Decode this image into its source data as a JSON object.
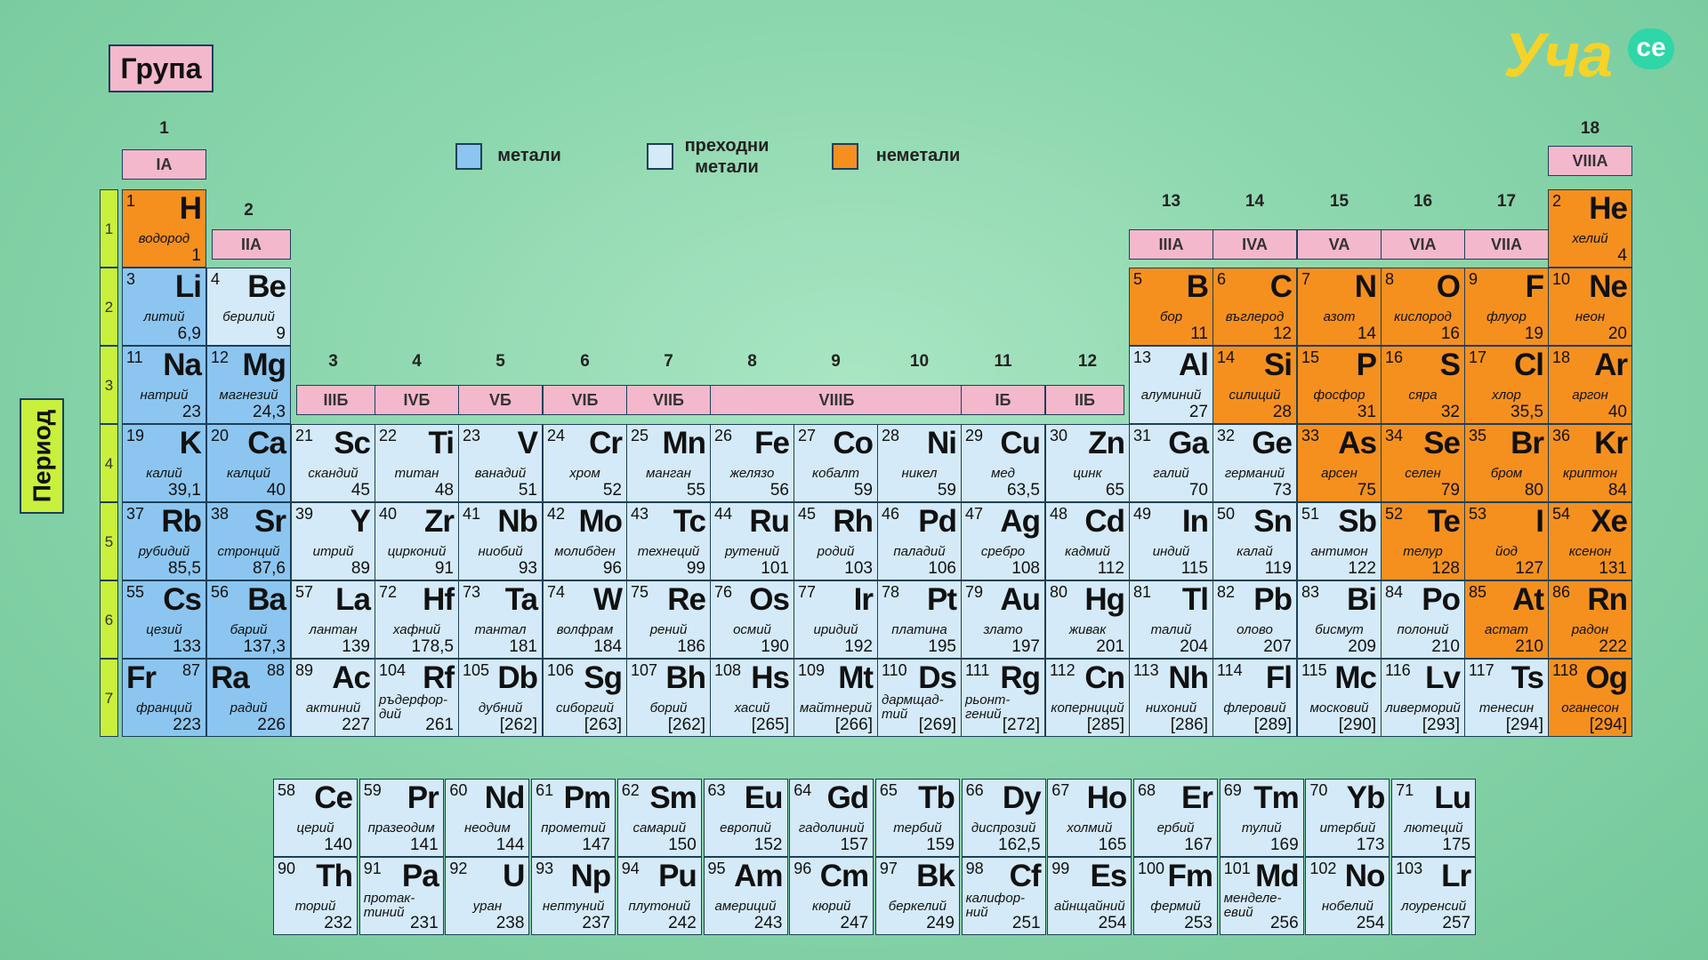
{
  "header": {
    "group_title": "Група",
    "period_title": "Период"
  },
  "logo": {
    "text": "Уча",
    "suffix": "се",
    "color_main": "#f5d327",
    "color_badge": "#2fd6a8"
  },
  "colors": {
    "metal": "#8cc6f0",
    "transition": "#d4eaf8",
    "nonmetal": "#f5901f",
    "label": "#f4b8cc",
    "period_bar": "#c8f03c"
  },
  "legend": [
    {
      "label": "метали",
      "category": "metal"
    },
    {
      "label": "преходни метали",
      "category": "trans"
    },
    {
      "label": "неметали",
      "category": "nonmetal"
    }
  ],
  "periods": [
    "1",
    "2",
    "3",
    "4",
    "5",
    "6",
    "7"
  ],
  "group_numbers": [
    "1",
    "2",
    "3",
    "4",
    "5",
    "6",
    "7",
    "8",
    "9",
    "10",
    "11",
    "12",
    "13",
    "14",
    "15",
    "16",
    "17",
    "18"
  ],
  "group_labels": {
    "g1": "IA",
    "g2": "IIA",
    "g3": "IIIБ",
    "g4": "IVБ",
    "g5": "VБ",
    "g6": "VIБ",
    "g7": "VIIБ",
    "g8_10": "VIIIБ",
    "g11": "IБ",
    "g12": "IIБ",
    "g13": "IIIA",
    "g14": "IVA",
    "g15": "VA",
    "g16": "VIA",
    "g17": "VIIA",
    "g18": "VIIIA"
  },
  "elements": [
    {
      "n": "1",
      "s": "H",
      "name": "водород",
      "m": "1",
      "r": 1,
      "c": 1,
      "cat": "nonmetal"
    },
    {
      "n": "2",
      "s": "He",
      "name": "хелий",
      "m": "4",
      "r": 1,
      "c": 18,
      "cat": "nonmetal"
    },
    {
      "n": "3",
      "s": "Li",
      "name": "литий",
      "m": "6,9",
      "r": 2,
      "c": 1,
      "cat": "metal"
    },
    {
      "n": "4",
      "s": "Be",
      "name": "берилий",
      "m": "9",
      "r": 2,
      "c": 2,
      "cat": "trans"
    },
    {
      "n": "5",
      "s": "B",
      "name": "бор",
      "m": "11",
      "r": 2,
      "c": 13,
      "cat": "nonmetal"
    },
    {
      "n": "6",
      "s": "C",
      "name": "въглерод",
      "m": "12",
      "r": 2,
      "c": 14,
      "cat": "nonmetal"
    },
    {
      "n": "7",
      "s": "N",
      "name": "азот",
      "m": "14",
      "r": 2,
      "c": 15,
      "cat": "nonmetal"
    },
    {
      "n": "8",
      "s": "O",
      "name": "кислород",
      "m": "16",
      "r": 2,
      "c": 16,
      "cat": "nonmetal"
    },
    {
      "n": "9",
      "s": "F",
      "name": "флуор",
      "m": "19",
      "r": 2,
      "c": 17,
      "cat": "nonmetal"
    },
    {
      "n": "10",
      "s": "Ne",
      "name": "неон",
      "m": "20",
      "r": 2,
      "c": 18,
      "cat": "nonmetal"
    },
    {
      "n": "11",
      "s": "Na",
      "name": "натрий",
      "m": "23",
      "r": 3,
      "c": 1,
      "cat": "metal"
    },
    {
      "n": "12",
      "s": "Mg",
      "name": "магнезий",
      "m": "24,3",
      "r": 3,
      "c": 2,
      "cat": "metal"
    },
    {
      "n": "13",
      "s": "Al",
      "name": "алуминий",
      "m": "27",
      "r": 3,
      "c": 13,
      "cat": "trans"
    },
    {
      "n": "14",
      "s": "Si",
      "name": "силиций",
      "m": "28",
      "r": 3,
      "c": 14,
      "cat": "nonmetal"
    },
    {
      "n": "15",
      "s": "P",
      "name": "фосфор",
      "m": "31",
      "r": 3,
      "c": 15,
      "cat": "nonmetal"
    },
    {
      "n": "16",
      "s": "S",
      "name": "сяра",
      "m": "32",
      "r": 3,
      "c": 16,
      "cat": "nonmetal"
    },
    {
      "n": "17",
      "s": "Cl",
      "name": "хлор",
      "m": "35,5",
      "r": 3,
      "c": 17,
      "cat": "nonmetal"
    },
    {
      "n": "18",
      "s": "Ar",
      "name": "аргон",
      "m": "40",
      "r": 3,
      "c": 18,
      "cat": "nonmetal"
    },
    {
      "n": "19",
      "s": "K",
      "name": "калий",
      "m": "39,1",
      "r": 4,
      "c": 1,
      "cat": "metal"
    },
    {
      "n": "20",
      "s": "Ca",
      "name": "калций",
      "m": "40",
      "r": 4,
      "c": 2,
      "cat": "metal"
    },
    {
      "n": "21",
      "s": "Sc",
      "name": "скандий",
      "m": "45",
      "r": 4,
      "c": 3,
      "cat": "trans"
    },
    {
      "n": "22",
      "s": "Ti",
      "name": "титан",
      "m": "48",
      "r": 4,
      "c": 4,
      "cat": "trans"
    },
    {
      "n": "23",
      "s": "V",
      "name": "ванадий",
      "m": "51",
      "r": 4,
      "c": 5,
      "cat": "trans"
    },
    {
      "n": "24",
      "s": "Cr",
      "name": "хром",
      "m": "52",
      "r": 4,
      "c": 6,
      "cat": "trans"
    },
    {
      "n": "25",
      "s": "Mn",
      "name": "манган",
      "m": "55",
      "r": 4,
      "c": 7,
      "cat": "trans"
    },
    {
      "n": "26",
      "s": "Fe",
      "name": "желязо",
      "m": "56",
      "r": 4,
      "c": 8,
      "cat": "trans"
    },
    {
      "n": "27",
      "s": "Co",
      "name": "кобалт",
      "m": "59",
      "r": 4,
      "c": 9,
      "cat": "trans"
    },
    {
      "n": "28",
      "s": "Ni",
      "name": "никел",
      "m": "59",
      "r": 4,
      "c": 10,
      "cat": "trans"
    },
    {
      "n": "29",
      "s": "Cu",
      "name": "мед",
      "m": "63,5",
      "r": 4,
      "c": 11,
      "cat": "trans"
    },
    {
      "n": "30",
      "s": "Zn",
      "name": "цинк",
      "m": "65",
      "r": 4,
      "c": 12,
      "cat": "trans"
    },
    {
      "n": "31",
      "s": "Ga",
      "name": "галий",
      "m": "70",
      "r": 4,
      "c": 13,
      "cat": "trans"
    },
    {
      "n": "32",
      "s": "Ge",
      "name": "германий",
      "m": "73",
      "r": 4,
      "c": 14,
      "cat": "trans"
    },
    {
      "n": "33",
      "s": "As",
      "name": "арсен",
      "m": "75",
      "r": 4,
      "c": 15,
      "cat": "nonmetal"
    },
    {
      "n": "34",
      "s": "Se",
      "name": "селен",
      "m": "79",
      "r": 4,
      "c": 16,
      "cat": "nonmetal"
    },
    {
      "n": "35",
      "s": "Br",
      "name": "бром",
      "m": "80",
      "r": 4,
      "c": 17,
      "cat": "nonmetal"
    },
    {
      "n": "36",
      "s": "Kr",
      "name": "криптон",
      "m": "84",
      "r": 4,
      "c": 18,
      "cat": "nonmetal"
    },
    {
      "n": "37",
      "s": "Rb",
      "name": "рубидий",
      "m": "85,5",
      "r": 5,
      "c": 1,
      "cat": "metal"
    },
    {
      "n": "38",
      "s": "Sr",
      "name": "стронций",
      "m": "87,6",
      "r": 5,
      "c": 2,
      "cat": "metal"
    },
    {
      "n": "39",
      "s": "Y",
      "name": "итрий",
      "m": "89",
      "r": 5,
      "c": 3,
      "cat": "trans"
    },
    {
      "n": "40",
      "s": "Zr",
      "name": "цирконий",
      "m": "91",
      "r": 5,
      "c": 4,
      "cat": "trans"
    },
    {
      "n": "41",
      "s": "Nb",
      "name": "ниобий",
      "m": "93",
      "r": 5,
      "c": 5,
      "cat": "trans"
    },
    {
      "n": "42",
      "s": "Mo",
      "name": "молибден",
      "m": "96",
      "r": 5,
      "c": 6,
      "cat": "trans"
    },
    {
      "n": "43",
      "s": "Tc",
      "name": "технеций",
      "m": "99",
      "r": 5,
      "c": 7,
      "cat": "trans"
    },
    {
      "n": "44",
      "s": "Ru",
      "name": "рутений",
      "m": "101",
      "r": 5,
      "c": 8,
      "cat": "trans"
    },
    {
      "n": "45",
      "s": "Rh",
      "name": "родий",
      "m": "103",
      "r": 5,
      "c": 9,
      "cat": "trans"
    },
    {
      "n": "46",
      "s": "Pd",
      "name": "паладий",
      "m": "106",
      "r": 5,
      "c": 10,
      "cat": "trans"
    },
    {
      "n": "47",
      "s": "Ag",
      "name": "сребро",
      "m": "108",
      "r": 5,
      "c": 11,
      "cat": "trans"
    },
    {
      "n": "48",
      "s": "Cd",
      "name": "кадмий",
      "m": "112",
      "r": 5,
      "c": 12,
      "cat": "trans"
    },
    {
      "n": "49",
      "s": "In",
      "name": "индий",
      "m": "115",
      "r": 5,
      "c": 13,
      "cat": "trans"
    },
    {
      "n": "50",
      "s": "Sn",
      "name": "калай",
      "m": "119",
      "r": 5,
      "c": 14,
      "cat": "trans"
    },
    {
      "n": "51",
      "s": "Sb",
      "name": "антимон",
      "m": "122",
      "r": 5,
      "c": 15,
      "cat": "trans"
    },
    {
      "n": "52",
      "s": "Te",
      "name": "телур",
      "m": "128",
      "r": 5,
      "c": 16,
      "cat": "nonmetal"
    },
    {
      "n": "53",
      "s": "I",
      "name": "йод",
      "m": "127",
      "r": 5,
      "c": 17,
      "cat": "nonmetal"
    },
    {
      "n": "54",
      "s": "Xe",
      "name": "ксенон",
      "m": "131",
      "r": 5,
      "c": 18,
      "cat": "nonmetal"
    },
    {
      "n": "55",
      "s": "Cs",
      "name": "цезий",
      "m": "133",
      "r": 6,
      "c": 1,
      "cat": "metal"
    },
    {
      "n": "56",
      "s": "Ba",
      "name": "барий",
      "m": "137,3",
      "r": 6,
      "c": 2,
      "cat": "metal"
    },
    {
      "n": "57",
      "s": "La",
      "name": "лантан",
      "m": "139",
      "r": 6,
      "c": 3,
      "cat": "trans"
    },
    {
      "n": "72",
      "s": "Hf",
      "name": "хафний",
      "m": "178,5",
      "r": 6,
      "c": 4,
      "cat": "trans"
    },
    {
      "n": "73",
      "s": "Ta",
      "name": "тантал",
      "m": "181",
      "r": 6,
      "c": 5,
      "cat": "trans"
    },
    {
      "n": "74",
      "s": "W",
      "name": "волфрам",
      "m": "184",
      "r": 6,
      "c": 6,
      "cat": "trans"
    },
    {
      "n": "75",
      "s": "Re",
      "name": "рений",
      "m": "186",
      "r": 6,
      "c": 7,
      "cat": "trans"
    },
    {
      "n": "76",
      "s": "Os",
      "name": "осмий",
      "m": "190",
      "r": 6,
      "c": 8,
      "cat": "trans"
    },
    {
      "n": "77",
      "s": "Ir",
      "name": "иридий",
      "m": "192",
      "r": 6,
      "c": 9,
      "cat": "trans"
    },
    {
      "n": "78",
      "s": "Pt",
      "name": "платина",
      "m": "195",
      "r": 6,
      "c": 10,
      "cat": "trans"
    },
    {
      "n": "79",
      "s": "Au",
      "name": "злато",
      "m": "197",
      "r": 6,
      "c": 11,
      "cat": "trans"
    },
    {
      "n": "80",
      "s": "Hg",
      "name": "живак",
      "m": "201",
      "r": 6,
      "c": 12,
      "cat": "trans"
    },
    {
      "n": "81",
      "s": "Tl",
      "name": "талий",
      "m": "204",
      "r": 6,
      "c": 13,
      "cat": "trans"
    },
    {
      "n": "82",
      "s": "Pb",
      "name": "олово",
      "m": "207",
      "r": 6,
      "c": 14,
      "cat": "trans"
    },
    {
      "n": "83",
      "s": "Bi",
      "name": "бисмут",
      "m": "209",
      "r": 6,
      "c": 15,
      "cat": "trans"
    },
    {
      "n": "84",
      "s": "Po",
      "name": "полоний",
      "m": "210",
      "r": 6,
      "c": 16,
      "cat": "trans"
    },
    {
      "n": "85",
      "s": "At",
      "name": "астат",
      "m": "210",
      "r": 6,
      "c": 17,
      "cat": "nonmetal"
    },
    {
      "n": "86",
      "s": "Rn",
      "name": "радон",
      "m": "222",
      "r": 6,
      "c": 18,
      "cat": "nonmetal"
    },
    {
      "n": "87",
      "s": "Fr",
      "name": "франций",
      "m": "223",
      "r": 7,
      "c": 1,
      "cat": "metal",
      "flip": true
    },
    {
      "n": "88",
      "s": "Ra",
      "name": "радий",
      "m": "226",
      "r": 7,
      "c": 2,
      "cat": "metal",
      "flip": true
    },
    {
      "n": "89",
      "s": "Ac",
      "name": "актиний",
      "m": "227",
      "r": 7,
      "c": 3,
      "cat": "trans"
    },
    {
      "n": "104",
      "s": "Rf",
      "name": "ръдерфор-\nдий",
      "m": "261",
      "r": 7,
      "c": 4,
      "cat": "trans"
    },
    {
      "n": "105",
      "s": "Db",
      "name": "дубний",
      "m": "[262]",
      "r": 7,
      "c": 5,
      "cat": "trans"
    },
    {
      "n": "106",
      "s": "Sg",
      "name": "сиборгий",
      "m": "[263]",
      "r": 7,
      "c": 6,
      "cat": "trans"
    },
    {
      "n": "107",
      "s": "Bh",
      "name": "борий",
      "m": "[262]",
      "r": 7,
      "c": 7,
      "cat": "trans"
    },
    {
      "n": "108",
      "s": "Hs",
      "name": "хасий",
      "m": "[265]",
      "r": 7,
      "c": 8,
      "cat": "trans"
    },
    {
      "n": "109",
      "s": "Mt",
      "name": "майтнерий",
      "m": "[266]",
      "r": 7,
      "c": 9,
      "cat": "trans"
    },
    {
      "n": "110",
      "s": "Ds",
      "name": "дармщад-\nтий",
      "m": "[269]",
      "r": 7,
      "c": 10,
      "cat": "trans"
    },
    {
      "n": "111",
      "s": "Rg",
      "name": "рьонт-\nгений",
      "m": "[272]",
      "r": 7,
      "c": 11,
      "cat": "trans"
    },
    {
      "n": "112",
      "s": "Cn",
      "name": "коперниций",
      "m": "[285]",
      "r": 7,
      "c": 12,
      "cat": "trans"
    },
    {
      "n": "113",
      "s": "Nh",
      "name": "нихоний",
      "m": "[286]",
      "r": 7,
      "c": 13,
      "cat": "trans"
    },
    {
      "n": "114",
      "s": "Fl",
      "name": "флеровий",
      "m": "[289]",
      "r": 7,
      "c": 14,
      "cat": "trans"
    },
    {
      "n": "115",
      "s": "Mc",
      "name": "московий",
      "m": "[290]",
      "r": 7,
      "c": 15,
      "cat": "trans"
    },
    {
      "n": "116",
      "s": "Lv",
      "name": "ливерморий",
      "m": "[293]",
      "r": 7,
      "c": 16,
      "cat": "trans"
    },
    {
      "n": "117",
      "s": "Ts",
      "name": "тенесин",
      "m": "[294]",
      "r": 7,
      "c": 17,
      "cat": "trans"
    },
    {
      "n": "118",
      "s": "Og",
      "name": "оганесон",
      "m": "[294]",
      "r": 7,
      "c": 18,
      "cat": "nonmetal"
    }
  ],
  "lanthanides": [
    {
      "n": "58",
      "s": "Ce",
      "name": "церий",
      "m": "140"
    },
    {
      "n": "59",
      "s": "Pr",
      "name": "празеодим",
      "m": "141"
    },
    {
      "n": "60",
      "s": "Nd",
      "name": "неодим",
      "m": "144"
    },
    {
      "n": "61",
      "s": "Pm",
      "name": "прометий",
      "m": "147"
    },
    {
      "n": "62",
      "s": "Sm",
      "name": "самарий",
      "m": "150"
    },
    {
      "n": "63",
      "s": "Eu",
      "name": "европий",
      "m": "152"
    },
    {
      "n": "64",
      "s": "Gd",
      "name": "гадолиний",
      "m": "157"
    },
    {
      "n": "65",
      "s": "Tb",
      "name": "тербий",
      "m": "159"
    },
    {
      "n": "66",
      "s": "Dy",
      "name": "диспрозий",
      "m": "162,5"
    },
    {
      "n": "67",
      "s": "Ho",
      "name": "холмий",
      "m": "165"
    },
    {
      "n": "68",
      "s": "Er",
      "name": "ербий",
      "m": "167"
    },
    {
      "n": "69",
      "s": "Tm",
      "name": "тулий",
      "m": "169"
    },
    {
      "n": "70",
      "s": "Yb",
      "name": "итербий",
      "m": "173"
    },
    {
      "n": "71",
      "s": "Lu",
      "name": "лютеций",
      "m": "175"
    }
  ],
  "actinides": [
    {
      "n": "90",
      "s": "Th",
      "name": "торий",
      "m": "232"
    },
    {
      "n": "91",
      "s": "Pa",
      "name": "протак-\nтиний",
      "m": "231"
    },
    {
      "n": "92",
      "s": "U",
      "name": "уран",
      "m": "238"
    },
    {
      "n": "93",
      "s": "Np",
      "name": "нептуний",
      "m": "237"
    },
    {
      "n": "94",
      "s": "Pu",
      "name": "плутоний",
      "m": "242"
    },
    {
      "n": "95",
      "s": "Am",
      "name": "америций",
      "m": "243"
    },
    {
      "n": "96",
      "s": "Cm",
      "name": "кюрий",
      "m": "247"
    },
    {
      "n": "97",
      "s": "Bk",
      "name": "беркелий",
      "m": "249"
    },
    {
      "n": "98",
      "s": "Cf",
      "name": "калифор-\nний",
      "m": "251"
    },
    {
      "n": "99",
      "s": "Es",
      "name": "айнщайний",
      "m": "254"
    },
    {
      "n": "100",
      "s": "Fm",
      "name": "фермий",
      "m": "253"
    },
    {
      "n": "101",
      "s": "Md",
      "name": "менделе-\nевий",
      "m": "256"
    },
    {
      "n": "102",
      "s": "No",
      "name": "нобелий",
      "m": "254"
    },
    {
      "n": "103",
      "s": "Lr",
      "name": "лоуренсий",
      "m": "257"
    }
  ]
}
